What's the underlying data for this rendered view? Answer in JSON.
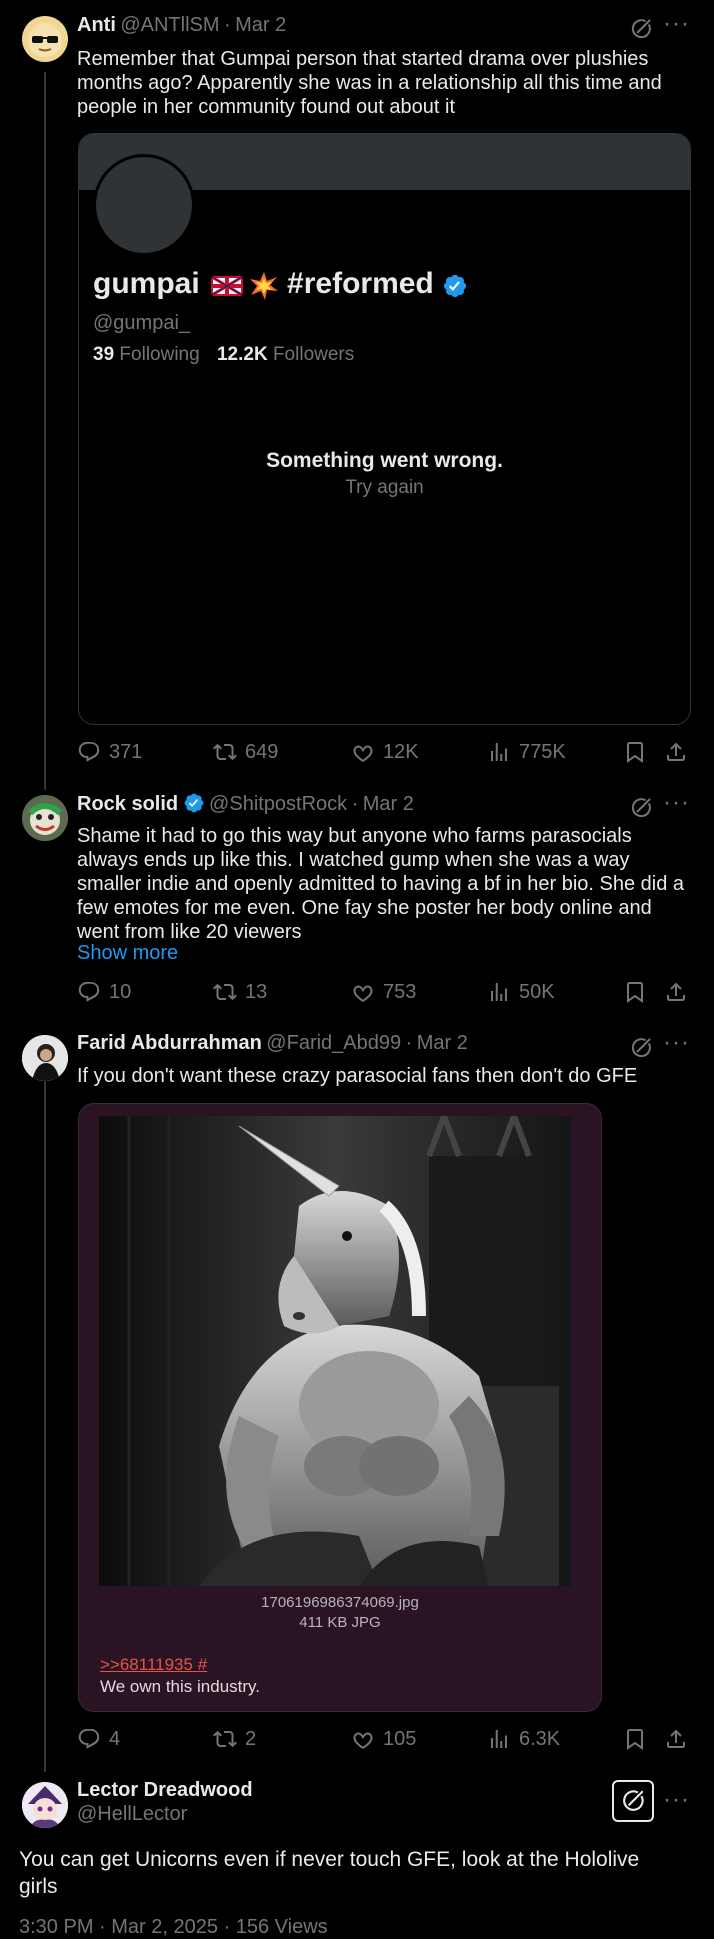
{
  "colors": {
    "background": "#000000",
    "text": "#e7e9ea",
    "muted": "#71767b",
    "accent": "#1d9bf0",
    "verified": "#1d9bf0"
  },
  "tweets": [
    {
      "name": "Anti",
      "handle": "@ANTllSM",
      "sep": "·",
      "date": "Mar 2",
      "text": "Remember that Gumpai person that started drama over plushies months ago? Apparently she was in a relationship all this time and people in her community found out about it",
      "actions": {
        "replies": "371",
        "reposts": "649",
        "likes": "12K",
        "views": "775K"
      }
    },
    {
      "name": "Rock solid",
      "handle": "@ShitpostRock",
      "sep": "·",
      "date": "Mar 2",
      "text": "Shame it had to go this way but anyone who farms parasocials always ends up like this. I watched gump when she was a way smaller indie and openly admitted to having a bf in her bio. She did a few emotes for me even. One fay she poster her body online and went from like 20 viewers",
      "show_more": "Show more",
      "actions": {
        "replies": "10",
        "reposts": "13",
        "likes": "753",
        "views": "50K"
      }
    },
    {
      "name": "Farid Abdurrahman",
      "handle": "@Farid_Abd99",
      "sep": "·",
      "date": "Mar 2",
      "text": "If you don't want these crazy parasocial fans then don't do GFE",
      "actions": {
        "replies": "4",
        "reposts": "2",
        "likes": "105",
        "views": "6.3K"
      }
    },
    {
      "name": "Lector Dreadwood",
      "handle": "@HellLector",
      "text": "You can get Unicorns even if never touch GFE, look at the Hololive girls",
      "footer": "3:30 PM · Mar 2, 2025 · 156 Views"
    }
  ],
  "profile_card": {
    "display_name": "gumpai",
    "hashtag": "#reformed",
    "handle": "@gumpai_",
    "following_count": "39",
    "following_label": "Following",
    "followers_count": "12.2K",
    "followers_label": "Followers",
    "error_title": "Something went wrong.",
    "error_action": "Try again"
  },
  "image_card": {
    "filename": "1706196986374069.jpg",
    "meta": "411 KB JPG",
    "quote_link": ">>68111935 #",
    "caption": "We own this industry."
  },
  "icons": [
    "grok-icon",
    "more-icon",
    "reply-icon",
    "repost-icon",
    "like-icon",
    "views-icon",
    "bookmark-icon",
    "share-icon",
    "verified-icon"
  ]
}
